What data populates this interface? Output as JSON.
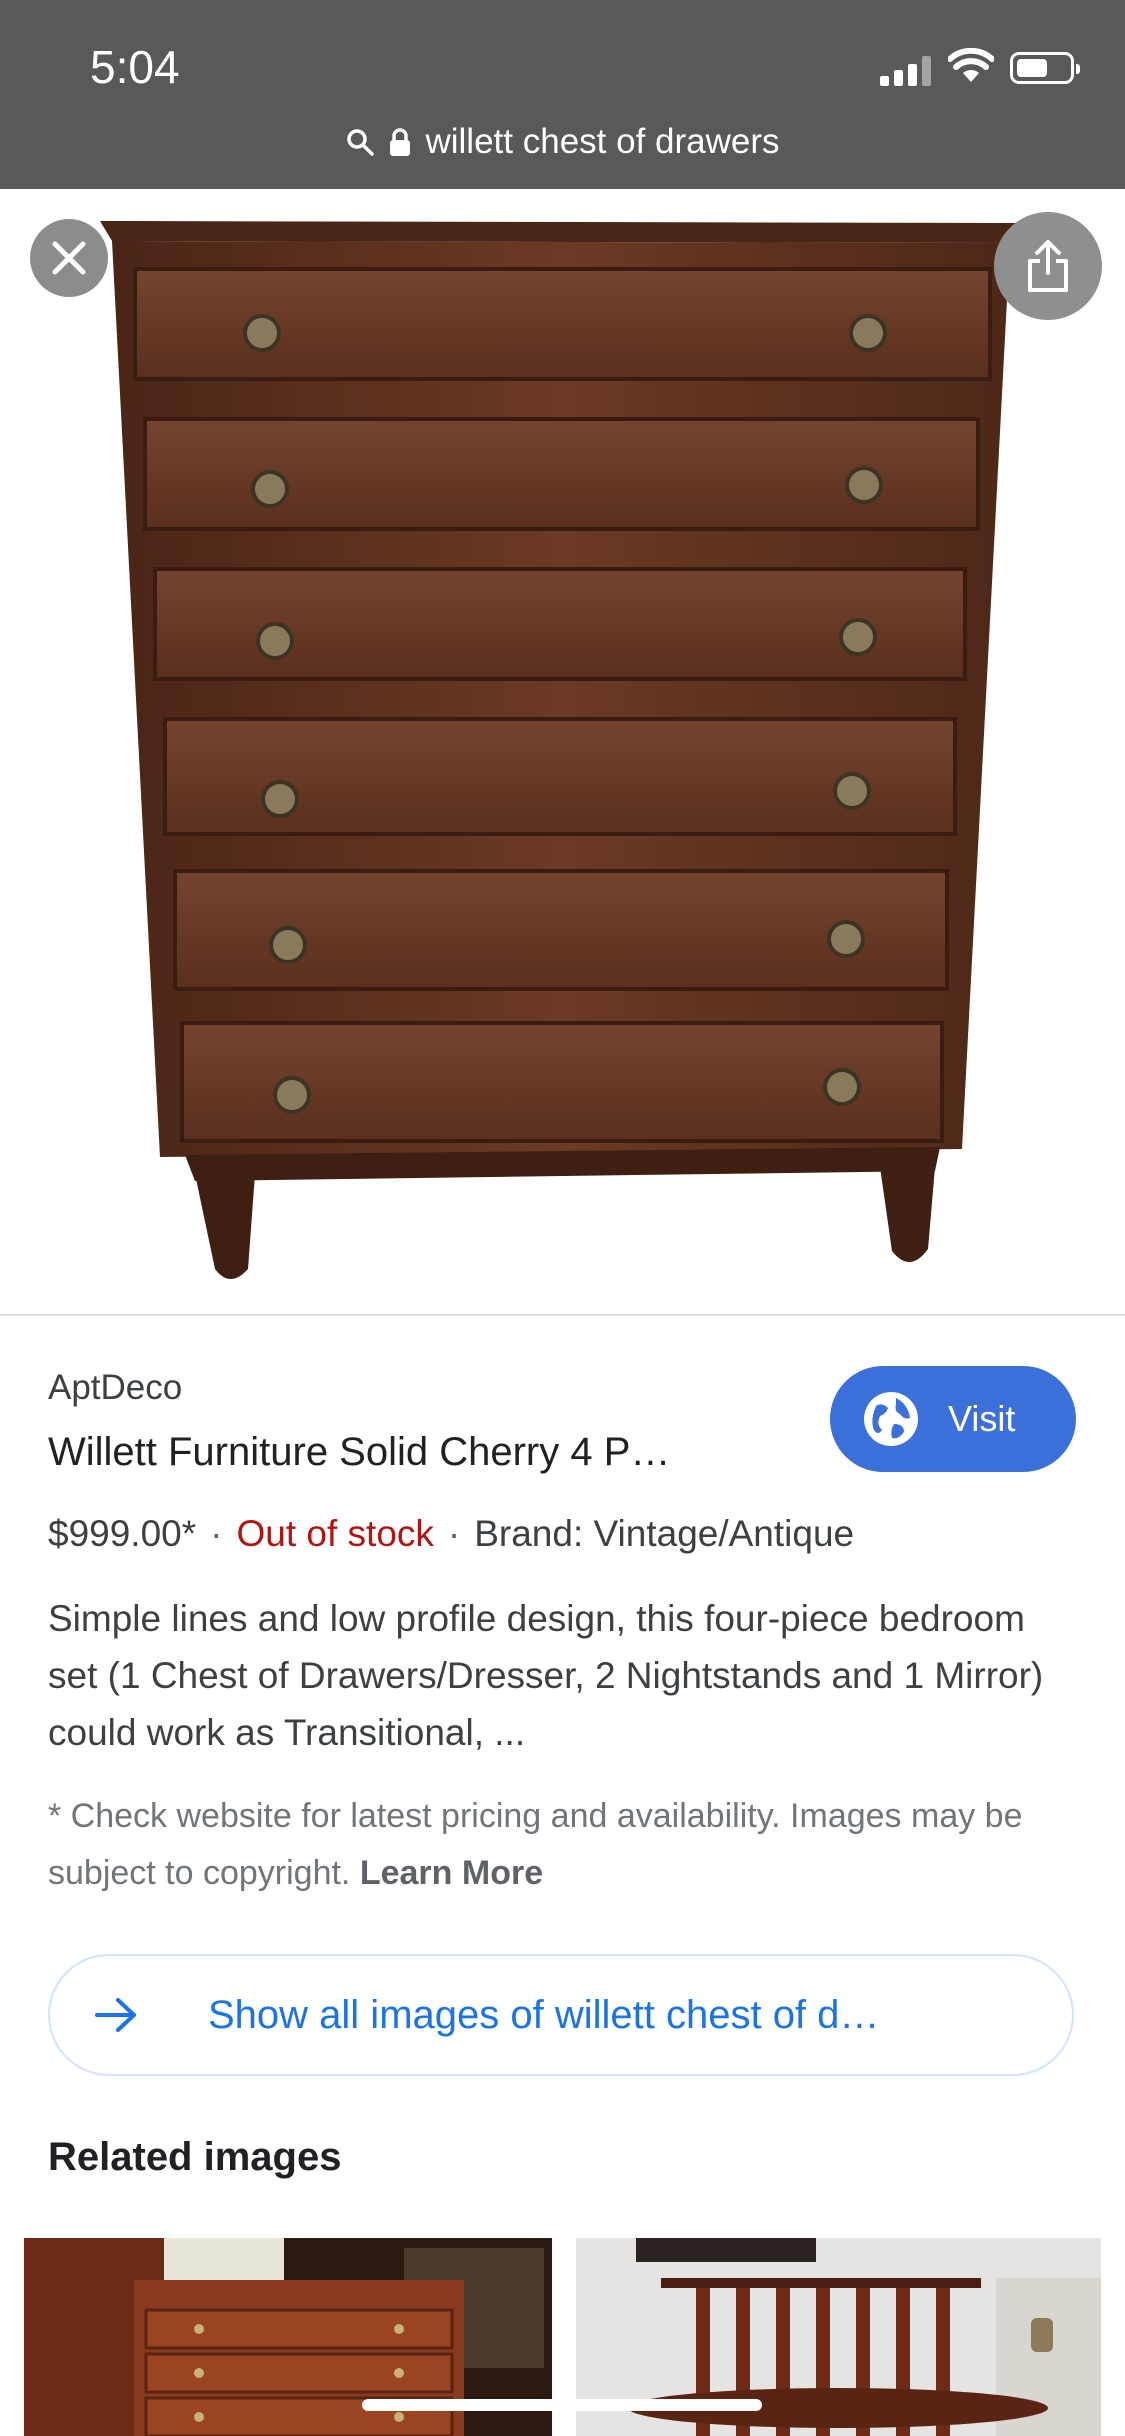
{
  "status": {
    "time": "5:04"
  },
  "urlbar": {
    "query": "willett chest of drawers"
  },
  "result": {
    "source": "AptDeco",
    "title": "Willett Furniture Solid Cherry 4 P…",
    "visit_label": "Visit",
    "price": "$999.00*",
    "stock": "Out of stock",
    "brand": "Brand: Vintage/Antique",
    "separator": "·",
    "description": "Simple lines and low profile design, this four-piece bedroom set (1 Chest of Drawers/Dresser, 2 Nightstands and 1 Mirror) could work as Transitional, ...",
    "disclaimer": "* Check website for latest pricing and availability. Images may be subject to copyright.",
    "learn_more": "Learn More"
  },
  "show_all_label": "Show all images of willett chest of d…",
  "related_title": "Related images",
  "colors": {
    "accent": "#1a73e8",
    "visit": "#3b6fd9",
    "out_of_stock": "#b31412",
    "wood": "#5a2f1d"
  }
}
